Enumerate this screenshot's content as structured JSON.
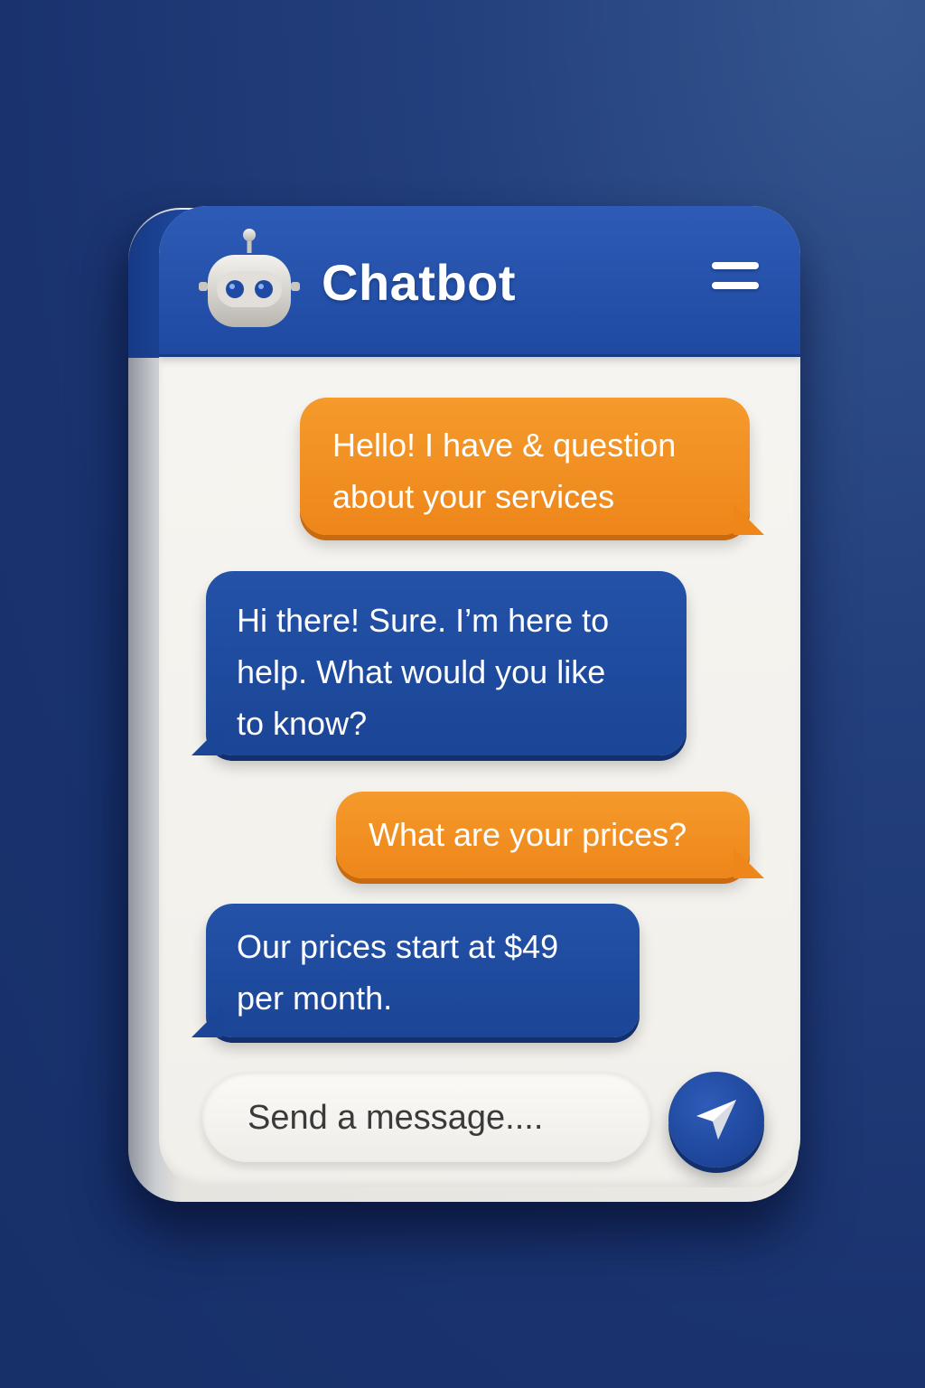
{
  "header": {
    "title": "Chatbot",
    "avatar_icon": "robot-icon",
    "menu_icon": "menu-icon",
    "color": "#1f4aa3"
  },
  "messages": [
    {
      "sender": "user",
      "text_lines": [
        "Hello! I have & question",
        "about your services"
      ]
    },
    {
      "sender": "bot",
      "text_lines": [
        "Hi there! Sure. I’m here to",
        "help. What would you like",
        "to know?"
      ]
    },
    {
      "sender": "user",
      "text_lines": [
        "What are your prices?"
      ]
    },
    {
      "sender": "bot",
      "text_lines": [
        "Our prices start at $49",
        "per month."
      ]
    }
  ],
  "composer": {
    "placeholder": "Send a message....",
    "value": "",
    "send_icon": "send-icon"
  },
  "colors": {
    "user_bubble": "#ee861a",
    "bot_bubble": "#1b4596",
    "background": "#1a336f",
    "card": "#f3f1ec"
  }
}
